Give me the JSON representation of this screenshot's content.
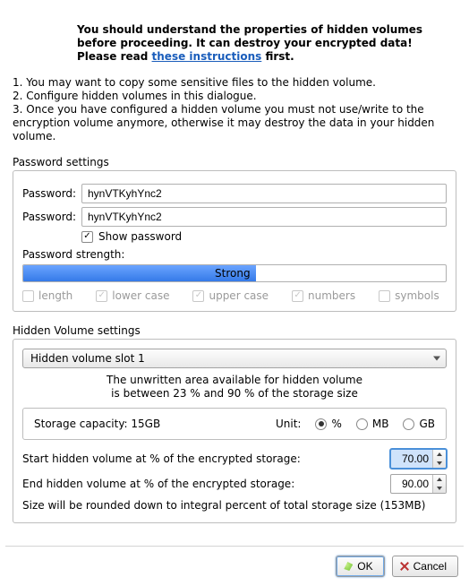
{
  "intro": {
    "warn_lead": "You should understand the properties of hidden volumes before proceeding. It can destroy your encrypted data! Please read ",
    "link_text": "these instructions",
    "warn_tail": " first."
  },
  "steps": {
    "s1": "1. You may want to copy some sensitive files to the hidden volume.",
    "s2": "2. Configure hidden volumes in this dialogue.",
    "s3": "3. Once you have configured a hidden volume you must not use/write to the encryption volume anymore, otherwise it may destroy the data in your hidden volume."
  },
  "password": {
    "section_label": "Password settings",
    "label": "Password:",
    "value1": "hynVTKyhYnc2",
    "value2": "hynVTKyhYnc2",
    "show_label": "Show password",
    "show_checked": true,
    "strength_label": "Password strength:",
    "strength_text": "Strong",
    "strength_percent": 55,
    "criteria": {
      "length": {
        "label": "length",
        "checked": false
      },
      "lower": {
        "label": "lower case",
        "checked": true
      },
      "upper": {
        "label": "upper case",
        "checked": true
      },
      "numbers": {
        "label": "numbers",
        "checked": true
      },
      "symbols": {
        "label": "symbols",
        "checked": false
      }
    }
  },
  "hidden": {
    "section_label": "Hidden Volume settings",
    "slot_selected": "Hidden volume slot 1",
    "avail_line1": "The unwritten area available for hidden volume",
    "avail_line2": "is between 23 % and 90 % of the storage size",
    "capacity_label": "Storage capacity: 15GB",
    "unit_label": "Unit:",
    "units": {
      "percent": "%",
      "mb": "MB",
      "gb": "GB",
      "selected": "percent"
    },
    "start_label": "Start hidden volume at % of the encrypted storage:",
    "start_value": "70.00",
    "end_label": "End hidden volume at % of the encrypted storage:",
    "end_value": "90.00",
    "round_note": "Size will be rounded down to integral percent of total storage size (153MB)"
  },
  "buttons": {
    "ok": "OK",
    "cancel": "Cancel"
  }
}
